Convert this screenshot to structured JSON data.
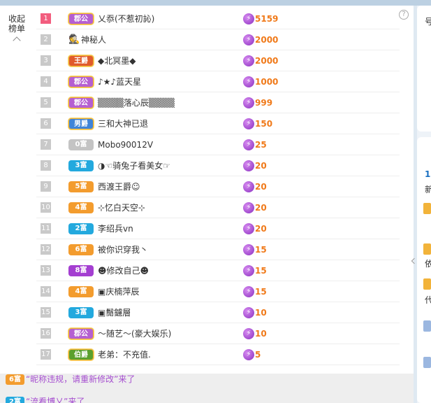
{
  "collapse": {
    "line1": "收起",
    "line2": "榜单"
  },
  "help": {
    "label": "?"
  },
  "rows": [
    {
      "rank": "1",
      "badge": "郡公",
      "badge_style": "noble-purple",
      "name": "乂忝(不惹初訫)",
      "score": "5159"
    },
    {
      "rank": "2",
      "badge": "🕵",
      "badge_style": "mystery",
      "name": "神秘人",
      "score": "2000"
    },
    {
      "rank": "3",
      "badge": "王爵",
      "badge_style": "noble-gold",
      "name": "◆北冥墨◆",
      "score": "2000"
    },
    {
      "rank": "4",
      "badge": "郡公",
      "badge_style": "noble-purple",
      "name": "♪★♪蓝天星",
      "score": "1000"
    },
    {
      "rank": "5",
      "badge": "郡公",
      "badge_style": "noble-purple",
      "name": "▒▒▒▒落心辰▒▒▒▒",
      "score": "999"
    },
    {
      "rank": "6",
      "badge": "男爵",
      "badge_style": "noble-blue",
      "name": "三和大神已退",
      "score": "150"
    },
    {
      "rank": "7",
      "badge": "0富",
      "badge_style": "wealth-gray",
      "name": "Mobo90012V",
      "score": "25"
    },
    {
      "rank": "8",
      "badge": "3富",
      "badge_style": "wealth-blue",
      "name": "◑☜骑兔子看美女☞",
      "score": "20"
    },
    {
      "rank": "9",
      "badge": "5富",
      "badge_style": "wealth-orange",
      "name": "西渡王爵☺",
      "score": "20"
    },
    {
      "rank": "10",
      "badge": "4富",
      "badge_style": "wealth-orange",
      "name": "⊹忆白天空⊹",
      "score": "20"
    },
    {
      "rank": "11",
      "badge": "2富",
      "badge_style": "wealth-blue",
      "name": "李绍兵vn",
      "score": "20"
    },
    {
      "rank": "12",
      "badge": "6富",
      "badge_style": "wealth-orange",
      "name": "被你识穿我丶",
      "score": "15"
    },
    {
      "rank": "13",
      "badge": "8富",
      "badge_style": "wealth-purple",
      "name": "☻修改自己☻",
      "score": "15"
    },
    {
      "rank": "14",
      "badge": "4富",
      "badge_style": "wealth-orange",
      "name": "▣庆楠萍辰",
      "score": "15"
    },
    {
      "rank": "15",
      "badge": "3富",
      "badge_style": "wealth-blue",
      "name": "▣鬜鑢層",
      "score": "10"
    },
    {
      "rank": "16",
      "badge": "郡公",
      "badge_style": "noble-purple",
      "name": "～随艺～(豪大娱乐)",
      "score": "10"
    },
    {
      "rank": "17",
      "badge": "伯爵",
      "badge_style": "noble-green",
      "name": "老弟：不充值.",
      "score": "5"
    }
  ],
  "chat": [
    {
      "badge": "6富",
      "badge_color": "#f39c2e",
      "text": "“昵称违规，请重新修改”来了"
    },
    {
      "badge": "2富",
      "badge_color": "#23a9de",
      "text": "“流看博乂”来了"
    }
  ],
  "side": {
    "chars": [
      "号",
      "1",
      "新",
      "依",
      "代"
    ]
  },
  "colors": {
    "accent": "#f07a1a",
    "rank_first": "#f25d7e",
    "coin": "#8a2fc0",
    "chat_text": "#a64fd0"
  }
}
